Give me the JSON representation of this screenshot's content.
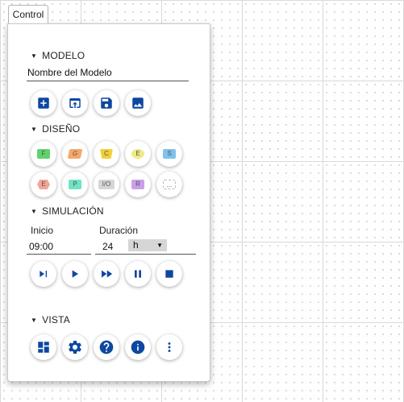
{
  "tab": {
    "label": "Control"
  },
  "sections": {
    "modelo": "MODELO",
    "diseno": "DISEÑO",
    "simulacion": "SIMULACIÓN",
    "vista": "VISTA"
  },
  "model": {
    "name": "Nombre del Modelo"
  },
  "model_actions": [
    {
      "icon": "add-box-icon"
    },
    {
      "icon": "open-upload-icon"
    },
    {
      "icon": "save-icon"
    },
    {
      "icon": "image-icon"
    }
  ],
  "design": {
    "row1": [
      {
        "label": "F",
        "color": "#5fd36b"
      },
      {
        "label": "G",
        "color": "#f5a86a"
      },
      {
        "label": "C",
        "color": "#f3cf3a"
      },
      {
        "label": "E",
        "color": "#f0ea86"
      },
      {
        "label": "S",
        "color": "#7ec3ec"
      }
    ],
    "row2": [
      {
        "label": "E",
        "color": "#f3a59a"
      },
      {
        "label": "P",
        "color": "#6fe3c2"
      },
      {
        "label": "I/O",
        "color": "#d6d6d6"
      },
      {
        "label": "R",
        "color": "#c9a0e8"
      },
      {
        "label": "...",
        "color": "#ffffff"
      }
    ]
  },
  "simulation": {
    "start_label": "Inicio",
    "start_value": "09:00",
    "duration_label": "Duración",
    "duration_value": "24",
    "unit_value": "h",
    "controls": [
      {
        "icon": "step-icon"
      },
      {
        "icon": "play-icon"
      },
      {
        "icon": "fast-forward-icon"
      },
      {
        "icon": "pause-icon"
      },
      {
        "icon": "stop-icon"
      }
    ]
  },
  "view_actions": [
    {
      "icon": "dashboard-icon"
    },
    {
      "icon": "settings-gear-icon"
    },
    {
      "icon": "help-icon"
    },
    {
      "icon": "info-icon"
    },
    {
      "icon": "more-vert-icon"
    }
  ],
  "colors": {
    "accent": "#0d47a1"
  }
}
